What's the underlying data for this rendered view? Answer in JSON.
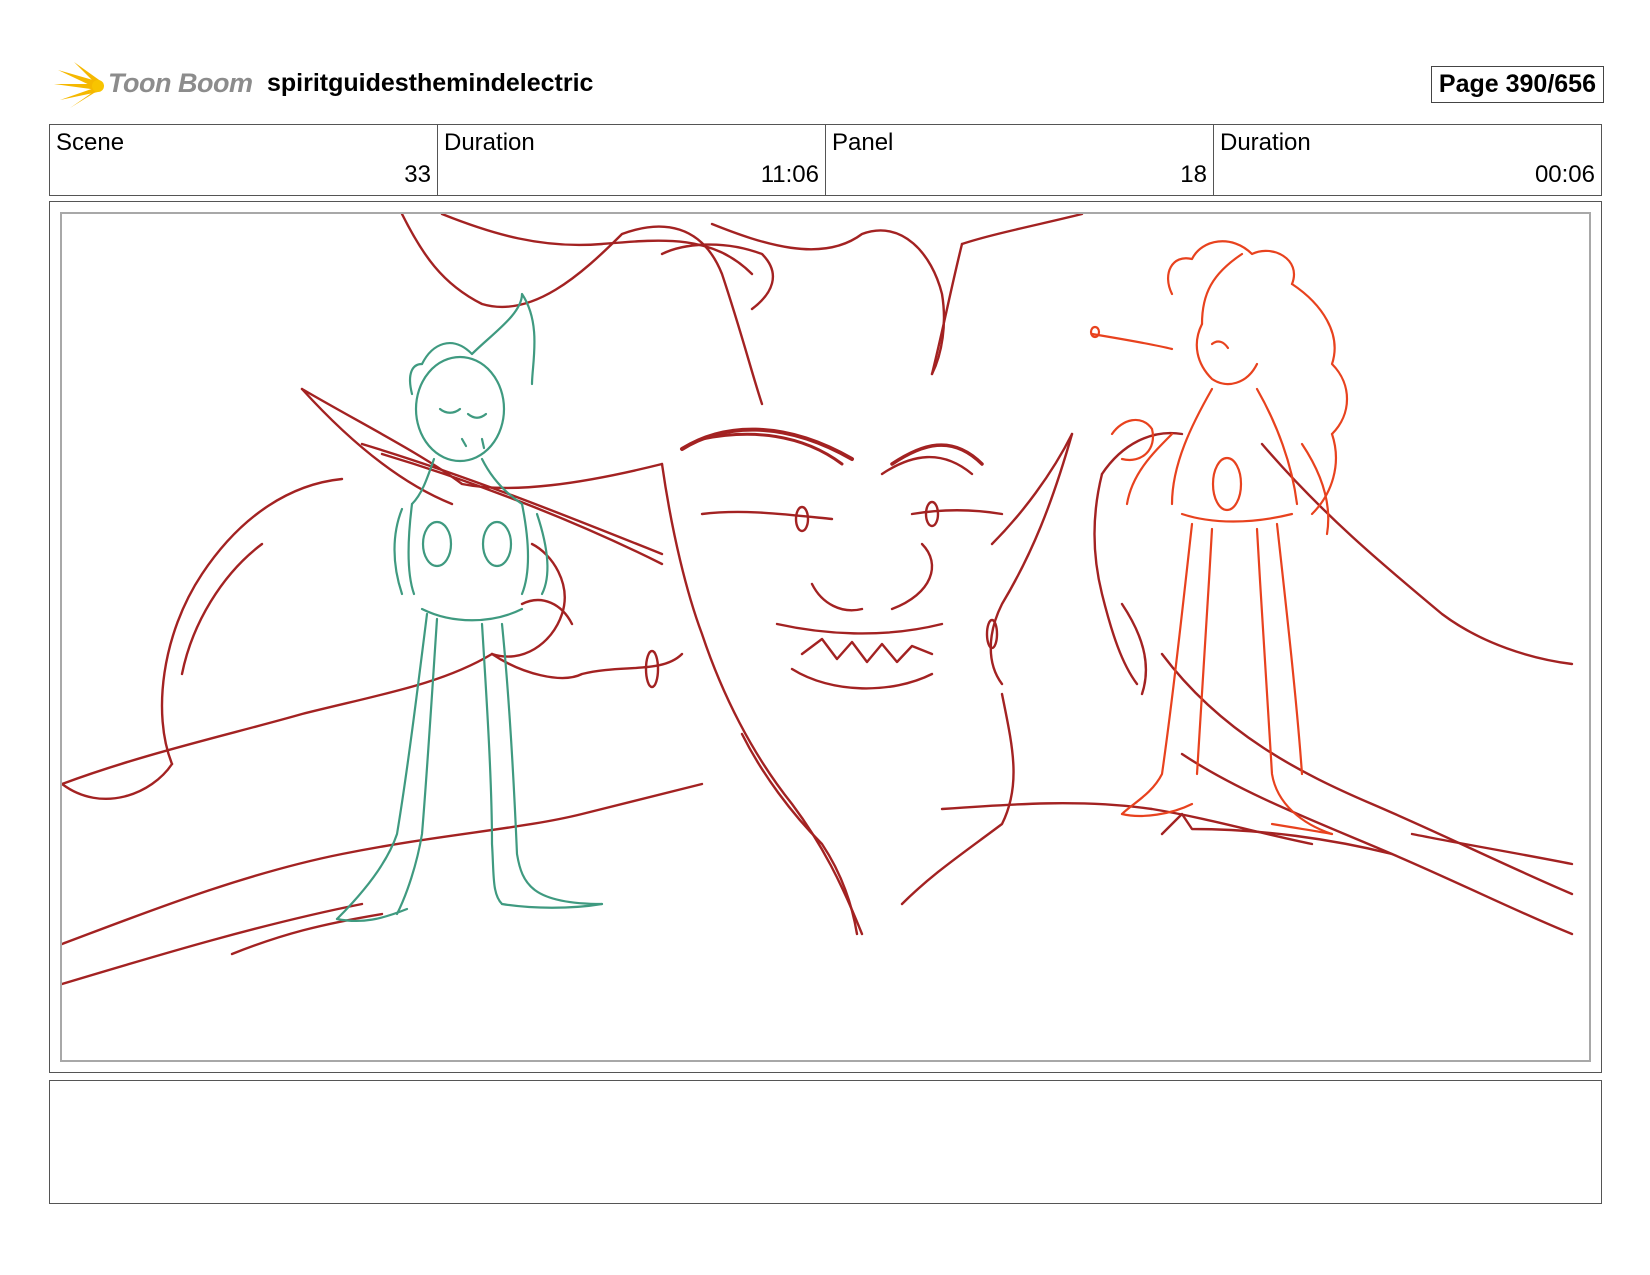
{
  "header": {
    "logo_text": "Toon Boom",
    "project_title": "spiritguidesthemindelectric",
    "page": "Page 390/656"
  },
  "info": {
    "scene_label": "Scene",
    "scene_value": "33",
    "scene_duration_label": "Duration",
    "scene_duration_value": "11:06",
    "panel_label": "Panel",
    "panel_value": "18",
    "panel_duration_label": "Duration",
    "panel_duration_value": "00:06"
  },
  "panel": {
    "sketch_colors": {
      "demon": "#a32222",
      "left_figure": "#3f9a80",
      "right_figure": "#e8421e"
    }
  },
  "notes": {
    "text": ""
  }
}
